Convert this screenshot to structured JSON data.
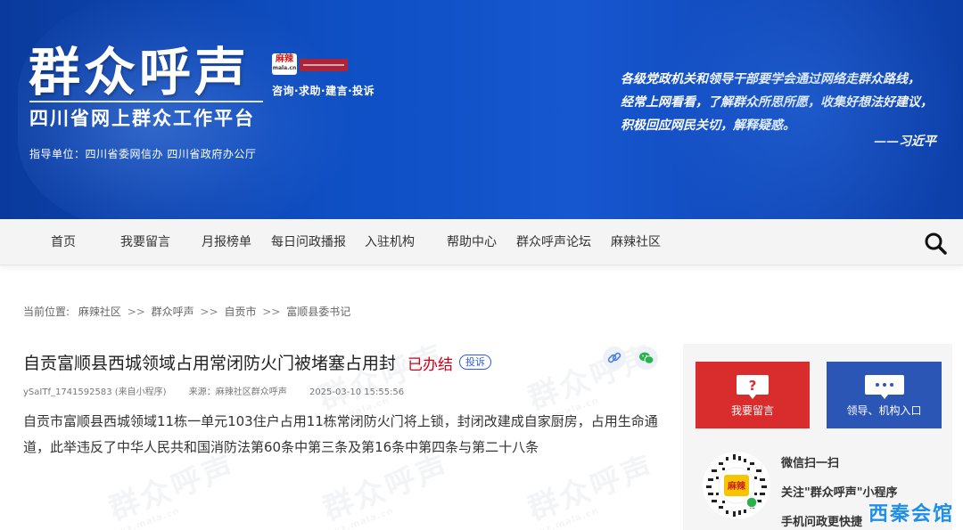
{
  "banner": {
    "title": "群众呼声",
    "badge": "麻辣",
    "badge_sub": "mala.cn",
    "tagline": "咨询·求助·建言·投诉",
    "subtitle": "四川省网上群众工作平台",
    "guide_unit": "指导单位：四川省委网信办 四川省政府办公厅",
    "quote_lines": [
      "各级党政机关和领导干部要学会通过网络走群众路线，",
      "经常上网看看，了解群众所思所愿，收集好想法好建议，",
      "积极回应网民关切，解释疑惑。"
    ],
    "quote_author": "——习近平"
  },
  "nav": {
    "items": [
      {
        "label": "首页"
      },
      {
        "label": "我要留言"
      },
      {
        "label": "月报榜单"
      },
      {
        "label": "每日问政播报"
      },
      {
        "label": "入驻机构"
      },
      {
        "label": "帮助中心"
      },
      {
        "label": "群众呼声论坛"
      },
      {
        "label": "麻辣社区"
      }
    ],
    "search_icon": "search-icon"
  },
  "breadcrumb": {
    "prefix": "当前位置:",
    "items": [
      "麻辣社区",
      "群众呼声",
      "自贡市",
      "富顺县委书记"
    ],
    "separator": ">>"
  },
  "article": {
    "title": "自贡富顺县西城领域占用常闭防火门被堵塞占用封",
    "status": "已办结",
    "complain_label": "投诉",
    "author": "ySaITf_1741592583 (来自小程序)",
    "source": "来源：麻辣社区群众呼声",
    "datetime": "2025-03-10 15:55:56",
    "body": "自贡市富顺县西城领域11栋一单元103住户占用11栋常闭防火门将上锁，封闭改建成自家厨房，占用生命通道，此举违反了中华人民共和国消防法第60条中第三条及第16条中第四条与第二十八条"
  },
  "watermark": {
    "text": "群众呼声",
    "sub": "wz.mala.cn"
  },
  "sidebar": {
    "message_button": "我要留言",
    "org_button": "领导、机构入口",
    "qr_line1": "微信扫一扫",
    "qr_line2": "关注\"群众呼声\"小程序",
    "qr_line3": "手机问政更快捷",
    "qr_center": "麻辣"
  },
  "corner_brand": "西秦会馆",
  "colors": {
    "banner_blue": "#0f4fc4",
    "status_red": "#d0021b",
    "message_red": "#d92d2d",
    "org_blue": "#2b56b5"
  }
}
